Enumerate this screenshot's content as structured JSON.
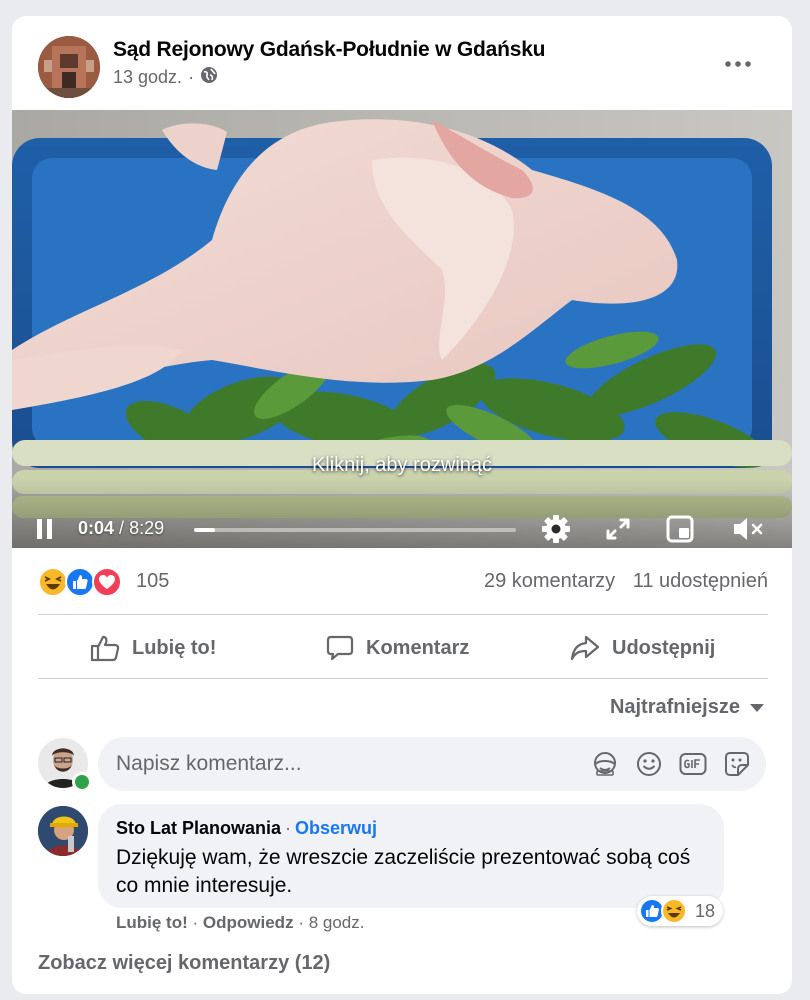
{
  "post": {
    "page_name": "Sąd Rejonowy Gdańsk-Południe w Gdańsku",
    "time": "13 godz.",
    "separator": "·",
    "privacy_icon": "globe-icon",
    "more_icon": "more-horizontal-icon"
  },
  "video": {
    "caption": "Kliknij, aby rozwinąć",
    "current_time": "0:04",
    "time_separator": "/",
    "duration": "8:29",
    "progress": 0.008,
    "icons": [
      "pause-icon",
      "settings-gear-icon",
      "fullscreen-icon",
      "mini-player-icon",
      "volume-muted-icon"
    ]
  },
  "reactions": {
    "count": "105",
    "types": [
      "haha",
      "like",
      "love"
    ],
    "comments": "29 komentarzy",
    "shares": "11 udostępnień"
  },
  "actions": {
    "like": "Lubię to!",
    "comment": "Komentarz",
    "share": "Udostępnij"
  },
  "comments_section": {
    "sort_label": "Najtrafniejsze",
    "input_placeholder": "Napisz komentarz...",
    "input_icons": [
      "avatar-sticker-icon",
      "emoji-icon",
      "gif-icon",
      "sticker-icon"
    ],
    "comment": {
      "author": "Sto Lat Planowania",
      "dot": "·",
      "follow": "Obserwuj",
      "text": "Dziękuję wam, że wreszcie zaczeliście prezentować sobą coś co mnie interesuje.",
      "reaction_count": "18",
      "like": "Lubię to!",
      "reply": "Odpowiedz",
      "time": "8 godz."
    },
    "see_more": "Zobacz więcej komentarzy (12)"
  },
  "colors": {
    "accent": "#1877f2",
    "secondary_text": "#65676b",
    "online": "#31a24c"
  }
}
